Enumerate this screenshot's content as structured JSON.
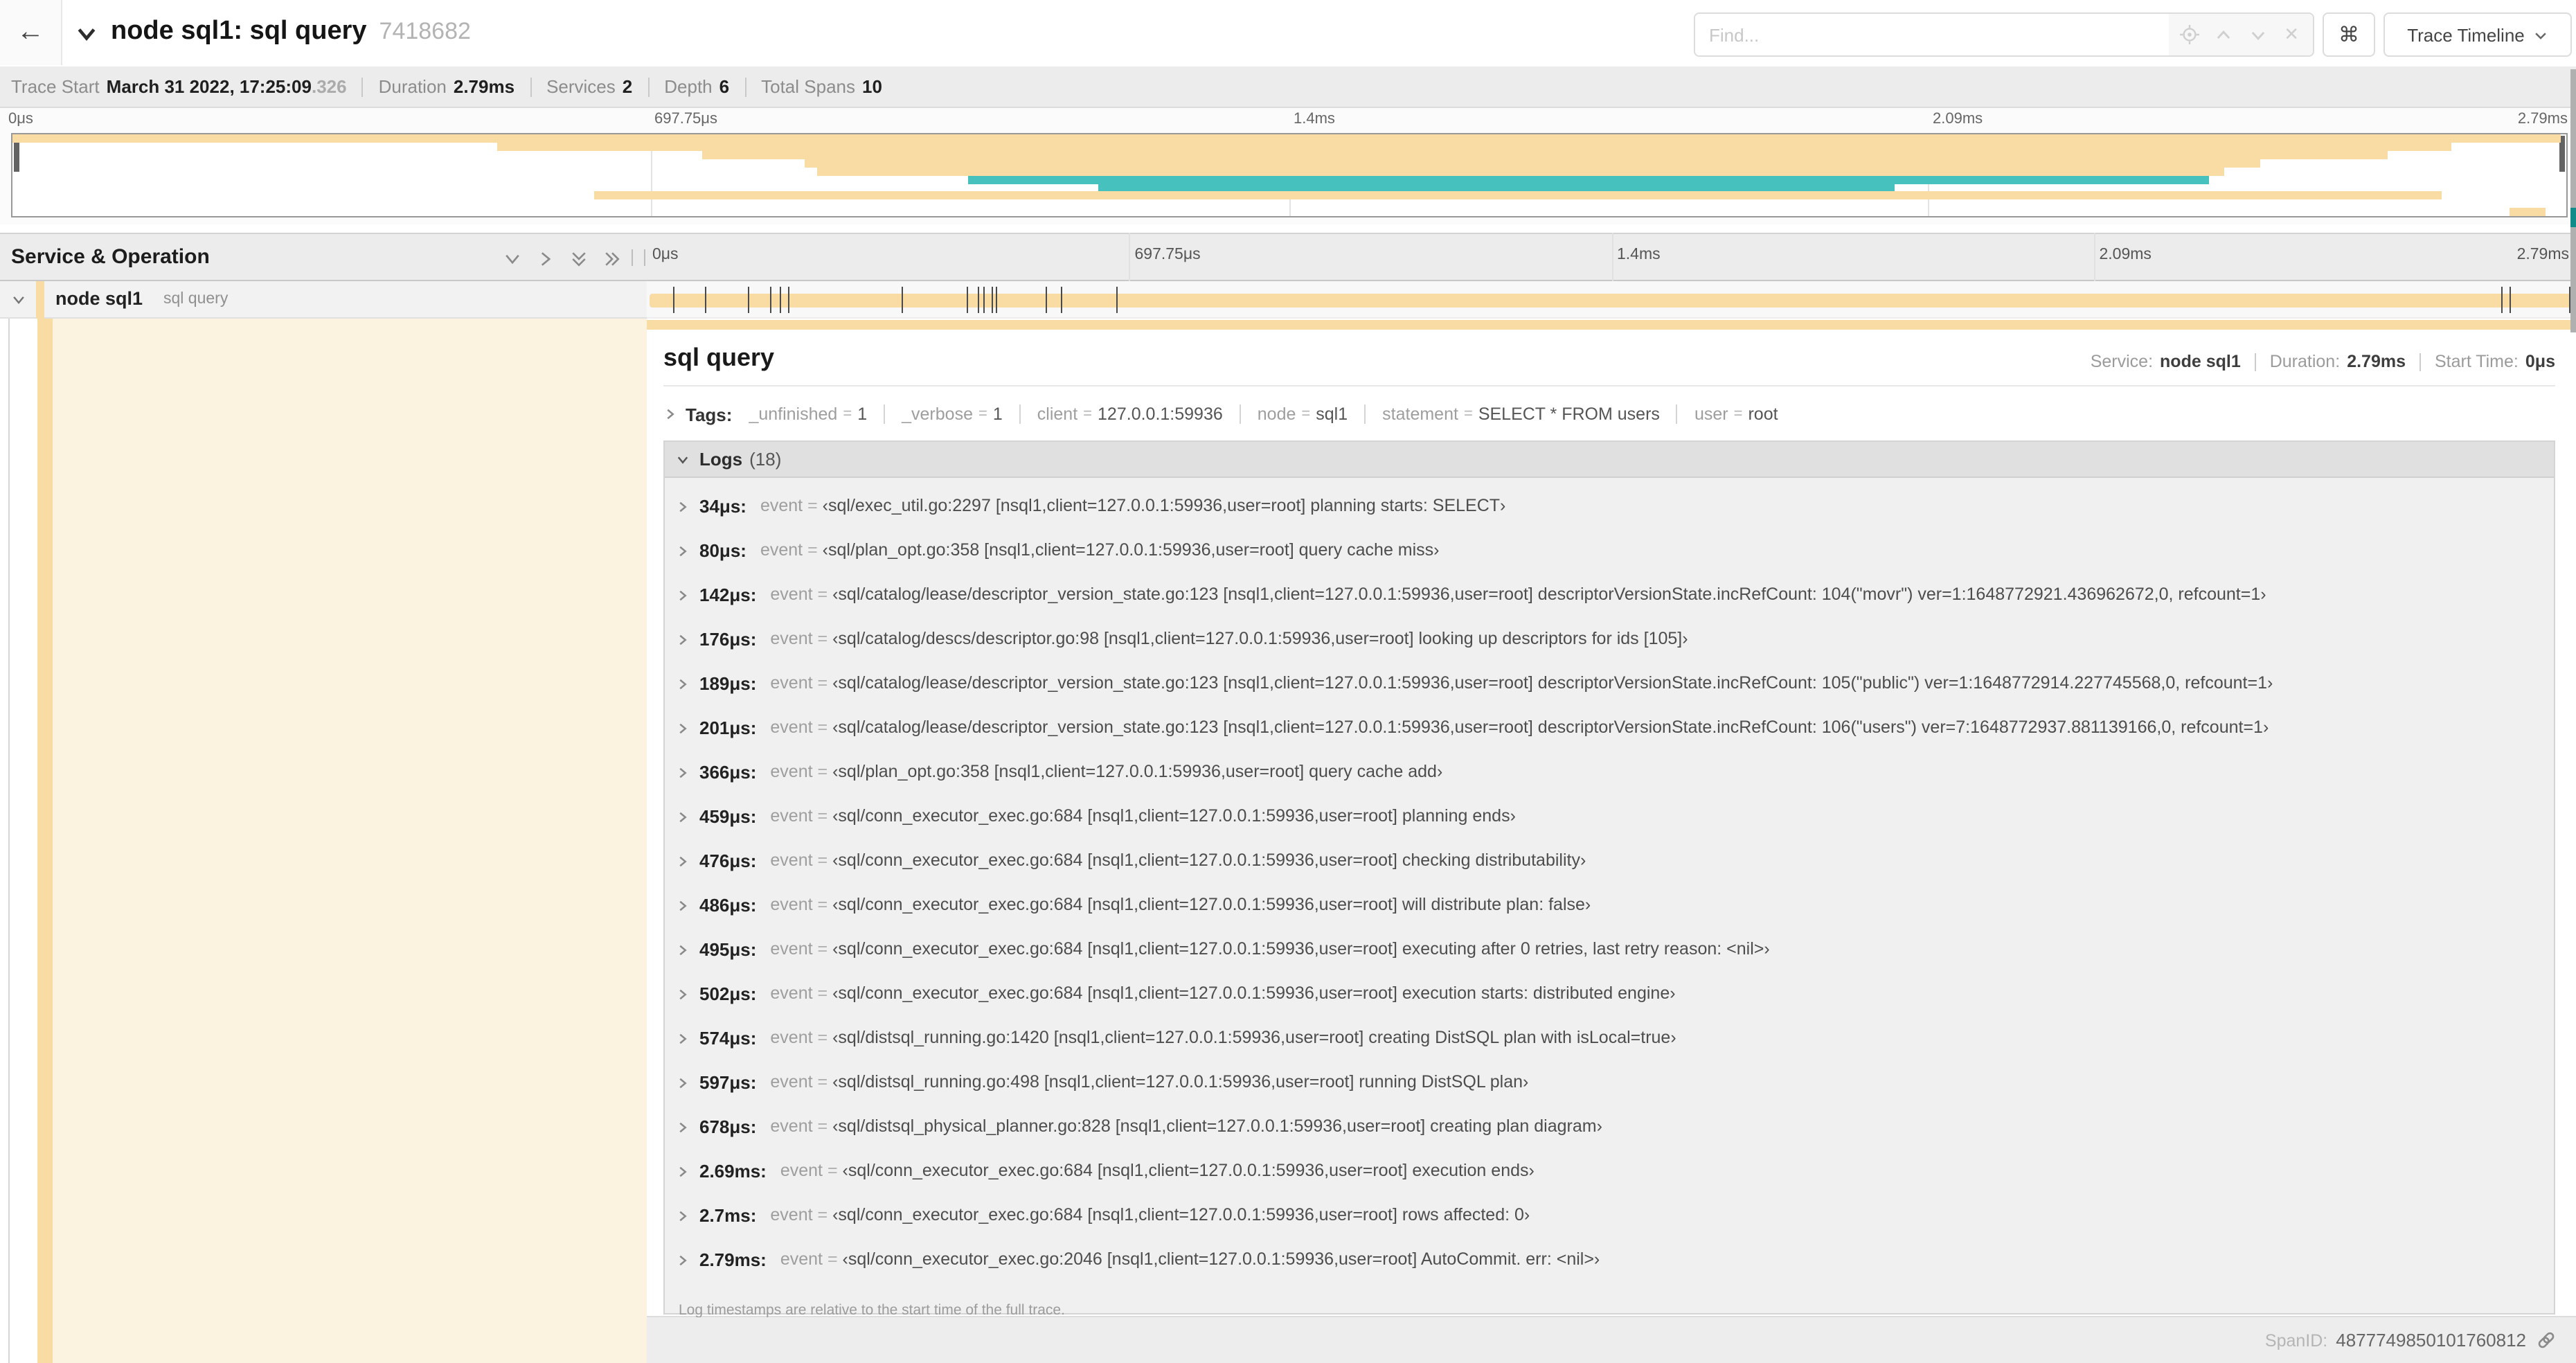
{
  "header": {
    "back": "←",
    "title": "node sql1: sql query",
    "trace_id": "7418682",
    "find_placeholder": "Find...",
    "shortcut_key": "⌘",
    "view_dropdown": "Trace Timeline"
  },
  "trace_info": [
    {
      "label": "Trace Start",
      "value": "March 31 2022, 17:25:09",
      "dim": ".326"
    },
    {
      "label": "Duration",
      "value": "2.79ms"
    },
    {
      "label": "Services",
      "value": "2"
    },
    {
      "label": "Depth",
      "value": "6"
    },
    {
      "label": "Total Spans",
      "value": "10"
    }
  ],
  "colors": {
    "tan": "#f8dca4",
    "teal": "#46c1bd",
    "cream": "#fbf3e0"
  },
  "minimap": {
    "ticks": [
      "0μs",
      "697.75μs",
      "1.4ms",
      "2.09ms",
      "2.79ms"
    ],
    "spans": [
      {
        "start": 0,
        "end": 99.8,
        "color": "tan"
      },
      {
        "start": 19,
        "end": 95.5,
        "color": "tan"
      },
      {
        "start": 27,
        "end": 93,
        "color": "tan"
      },
      {
        "start": 31,
        "end": 88,
        "color": "tan"
      },
      {
        "start": 31.5,
        "end": 86.6,
        "color": "tan"
      },
      {
        "start": 37.4,
        "end": 86,
        "color": "teal"
      },
      {
        "start": 42.5,
        "end": 73.7,
        "color": "teal"
      },
      {
        "start": 22.8,
        "end": 95.1,
        "color": "tan"
      },
      {
        "start": 0,
        "end": 0,
        "color": "none"
      },
      {
        "start": 97.8,
        "end": 99.2,
        "color": "tan"
      }
    ]
  },
  "timeline": {
    "left_header": "Service & Operation",
    "ticks": [
      "0μs",
      "697.75μs",
      "1.4ms",
      "2.09ms",
      "2.79ms"
    ]
  },
  "span_row": {
    "service": "node sql1",
    "operation": "sql query",
    "log_marks_pct": [
      1.2,
      2.9,
      5.1,
      6.3,
      6.8,
      7.2,
      13.1,
      16.5,
      17.1,
      17.4,
      17.8,
      18.0,
      20.6,
      21.4,
      24.3,
      96.4,
      96.8,
      99.9
    ]
  },
  "detail": {
    "title": "sql query",
    "meta": [
      {
        "label": "Service:",
        "value": "node sql1"
      },
      {
        "label": "Duration:",
        "value": "2.79ms"
      },
      {
        "label": "Start Time:",
        "value": "0μs"
      }
    ],
    "tags_label": "Tags:",
    "tags": [
      {
        "key": "_unfinished",
        "value": "1"
      },
      {
        "key": "_verbose",
        "value": "1"
      },
      {
        "key": "client",
        "value": "127.0.0.1:59936"
      },
      {
        "key": "node",
        "value": "sql1"
      },
      {
        "key": "statement",
        "value": "SELECT * FROM users"
      },
      {
        "key": "user",
        "value": "root"
      }
    ],
    "logs_label": "Logs",
    "logs_count": "(18)",
    "log_field_key": "event",
    "logs": [
      {
        "time": "34μs:",
        "value": "‹sql/exec_util.go:2297 [nsql1,client=127.0.0.1:59936,user=root] planning starts: SELECT›"
      },
      {
        "time": "80μs:",
        "value": "‹sql/plan_opt.go:358 [nsql1,client=127.0.0.1:59936,user=root] query cache miss›"
      },
      {
        "time": "142μs:",
        "value": "‹sql/catalog/lease/descriptor_version_state.go:123 [nsql1,client=127.0.0.1:59936,user=root] descriptorVersionState.incRefCount: 104(\"movr\") ver=1:1648772921.436962672,0, refcount=1›"
      },
      {
        "time": "176μs:",
        "value": "‹sql/catalog/descs/descriptor.go:98 [nsql1,client=127.0.0.1:59936,user=root] looking up descriptors for ids [105]›"
      },
      {
        "time": "189μs:",
        "value": "‹sql/catalog/lease/descriptor_version_state.go:123 [nsql1,client=127.0.0.1:59936,user=root] descriptorVersionState.incRefCount: 105(\"public\") ver=1:1648772914.227745568,0, refcount=1›"
      },
      {
        "time": "201μs:",
        "value": "‹sql/catalog/lease/descriptor_version_state.go:123 [nsql1,client=127.0.0.1:59936,user=root] descriptorVersionState.incRefCount: 106(\"users\") ver=7:1648772937.881139166,0, refcount=1›"
      },
      {
        "time": "366μs:",
        "value": "‹sql/plan_opt.go:358 [nsql1,client=127.0.0.1:59936,user=root] query cache add›"
      },
      {
        "time": "459μs:",
        "value": "‹sql/conn_executor_exec.go:684 [nsql1,client=127.0.0.1:59936,user=root] planning ends›"
      },
      {
        "time": "476μs:",
        "value": "‹sql/conn_executor_exec.go:684 [nsql1,client=127.0.0.1:59936,user=root] checking distributability›"
      },
      {
        "time": "486μs:",
        "value": "‹sql/conn_executor_exec.go:684 [nsql1,client=127.0.0.1:59936,user=root] will distribute plan: false›"
      },
      {
        "time": "495μs:",
        "value": "‹sql/conn_executor_exec.go:684 [nsql1,client=127.0.0.1:59936,user=root] executing after 0 retries, last retry reason: <nil>›"
      },
      {
        "time": "502μs:",
        "value": "‹sql/conn_executor_exec.go:684 [nsql1,client=127.0.0.1:59936,user=root] execution starts: distributed engine›"
      },
      {
        "time": "574μs:",
        "value": "‹sql/distsql_running.go:1420 [nsql1,client=127.0.0.1:59936,user=root] creating DistSQL plan with isLocal=true›"
      },
      {
        "time": "597μs:",
        "value": "‹sql/distsql_running.go:498 [nsql1,client=127.0.0.1:59936,user=root] running DistSQL plan›"
      },
      {
        "time": "678μs:",
        "value": "‹sql/distsql_physical_planner.go:828 [nsql1,client=127.0.0.1:59936,user=root] creating plan diagram›"
      },
      {
        "time": "2.69ms:",
        "value": "‹sql/conn_executor_exec.go:684 [nsql1,client=127.0.0.1:59936,user=root] execution ends›"
      },
      {
        "time": "2.7ms:",
        "value": "‹sql/conn_executor_exec.go:684 [nsql1,client=127.0.0.1:59936,user=root] rows affected: 0›"
      },
      {
        "time": "2.79ms:",
        "value": "‹sql/conn_executor_exec.go:2046 [nsql1,client=127.0.0.1:59936,user=root] AutoCommit. err: <nil>›"
      }
    ],
    "footnote": "Log timestamps are relative to the start time of the full trace.",
    "span_id_label": "SpanID:",
    "span_id": "4877749850101760812"
  }
}
